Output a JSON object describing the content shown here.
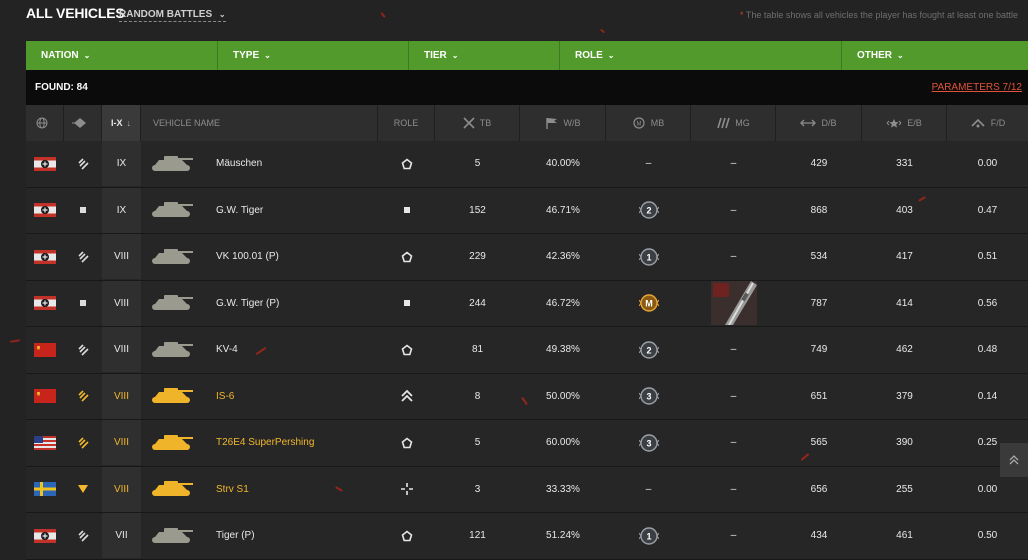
{
  "page": {
    "title": "ALL VEHICLES",
    "battle_type": "RANDOM BATTLES",
    "note": "The table shows all vehicles the player has fought at least one battle",
    "note_prefix": "*"
  },
  "filters": [
    {
      "label": "NATION"
    },
    {
      "label": "TYPE"
    },
    {
      "label": "TIER"
    },
    {
      "label": "ROLE"
    },
    {
      "label": "OTHER"
    }
  ],
  "found": "FOUND: 84",
  "parameters_link": "PARAMETERS 7/12",
  "columns": {
    "tier": "I-X",
    "tier_sort": "↓",
    "vehicle_name": "VEHICLE NAME",
    "role": "ROLE",
    "tb": "TB",
    "wb": "W/B",
    "mb": "MB",
    "mg": "MG",
    "db": "D/B",
    "eb": "E/B",
    "fd": "F/D"
  },
  "rows": [
    {
      "nation": "germany",
      "type": "heavy",
      "tier": "IX",
      "name": "Mäuschen",
      "role": "pentagon",
      "tb": "5",
      "wb": "40.00%",
      "mb": "–",
      "mb_badge": "",
      "mg": "–",
      "db": "429",
      "eb": "331",
      "fd": "0.00",
      "gold": false
    },
    {
      "nation": "germany",
      "type": "spg",
      "tier": "IX",
      "name": "G.W. Tiger",
      "role": "square",
      "tb": "152",
      "wb": "46.71%",
      "mb": "",
      "mb_badge": "2",
      "mg": "–",
      "db": "868",
      "eb": "403",
      "fd": "0.47",
      "gold": false
    },
    {
      "nation": "germany",
      "type": "heavy",
      "tier": "VIII",
      "name": "VK 100.01 (P)",
      "role": "pentagon",
      "tb": "229",
      "wb": "42.36%",
      "mb": "",
      "mb_badge": "1",
      "mg": "–",
      "db": "534",
      "eb": "417",
      "fd": "0.51",
      "gold": false
    },
    {
      "nation": "germany",
      "type": "spg",
      "tier": "VIII",
      "name": "G.W. Tiger (P)",
      "role": "square",
      "tb": "244",
      "wb": "46.72%",
      "mb": "",
      "mb_badge": "M",
      "mg": "gun-image",
      "db": "787",
      "eb": "414",
      "fd": "0.56",
      "gold": false
    },
    {
      "nation": "ussr",
      "type": "heavy",
      "tier": "VIII",
      "name": "KV-4",
      "role": "pentagon",
      "tb": "81",
      "wb": "49.38%",
      "mb": "",
      "mb_badge": "2",
      "mg": "–",
      "db": "749",
      "eb": "462",
      "fd": "0.48",
      "gold": false
    },
    {
      "nation": "ussr",
      "type": "heavy",
      "tier": "VIII",
      "name": "IS-6",
      "role": "chevrons",
      "tb": "8",
      "wb": "50.00%",
      "mb": "",
      "mb_badge": "3",
      "mg": "–",
      "db": "651",
      "eb": "379",
      "fd": "0.14",
      "gold": true
    },
    {
      "nation": "usa",
      "type": "heavy",
      "tier": "VIII",
      "name": "T26E4 SuperPershing",
      "role": "pentagon",
      "tb": "5",
      "wb": "60.00%",
      "mb": "",
      "mb_badge": "3",
      "mg": "–",
      "db": "565",
      "eb": "390",
      "fd": "0.25",
      "gold": true
    },
    {
      "nation": "sweden",
      "type": "td",
      "tier": "VIII",
      "name": "Strv S1",
      "role": "crosshair",
      "tb": "3",
      "wb": "33.33%",
      "mb": "–",
      "mb_badge": "",
      "mg": "–",
      "db": "656",
      "eb": "255",
      "fd": "0.00",
      "gold": true
    },
    {
      "nation": "germany",
      "type": "heavy",
      "tier": "VII",
      "name": "Tiger (P)",
      "role": "pentagon",
      "tb": "121",
      "wb": "51.24%",
      "mb": "",
      "mb_badge": "1",
      "mg": "–",
      "db": "434",
      "eb": "461",
      "fd": "0.50",
      "gold": false
    }
  ]
}
